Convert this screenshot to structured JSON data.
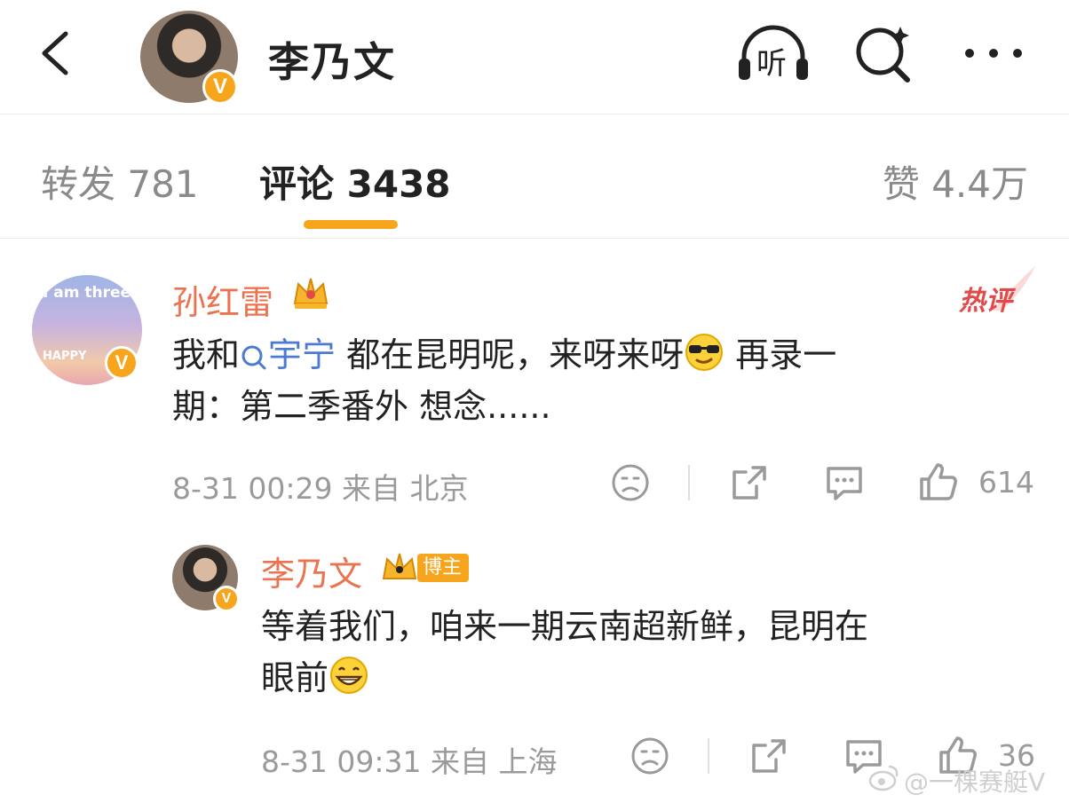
{
  "header": {
    "title": "李乃文",
    "listen_label": "听"
  },
  "tabs": {
    "repost": "转发 781",
    "comment": "评论 3438",
    "like": "赞 4.4万"
  },
  "comments": [
    {
      "author": "孙红雷",
      "hot_label": "热评",
      "avatar_text": "I am three",
      "avatar_text2": "HAPPY",
      "text_before": "我和",
      "topic": "宇宁",
      "text_mid": " 都在昆明呢，来呀来呀",
      "text_after": " 再录一",
      "line2": "期：第二季番外 想念......",
      "meta": "8-31 00:29  来自 北京",
      "likes": "614"
    },
    {
      "author": "李乃文",
      "badge": "博主",
      "line1": "等着我们，咱来一期云南超新鲜，昆明在",
      "line2": "眼前",
      "meta": "8-31 09:31  来自 上海",
      "likes": "36"
    }
  ],
  "watermark": "@一棵赛艇V",
  "colors": {
    "accent": "#f7a51c",
    "name": "#eb7350",
    "link": "#4c7bd4",
    "hot": "#e24a4a"
  }
}
